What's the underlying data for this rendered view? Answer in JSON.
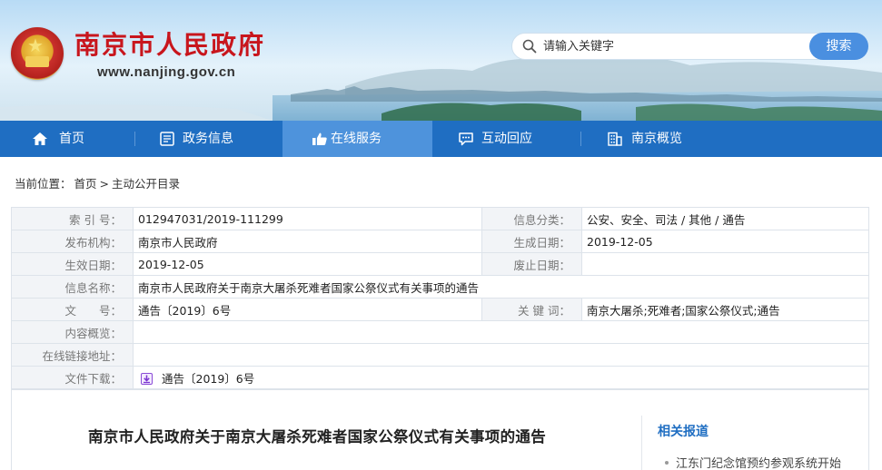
{
  "header": {
    "site_title": "南京市人民政府",
    "site_domain": "www.nanjing.gov.cn",
    "search_placeholder": "请输入关键字",
    "search_button": "搜索"
  },
  "nav": {
    "items": [
      {
        "label": "首页",
        "icon": "home-icon"
      },
      {
        "label": "政务信息",
        "icon": "document-icon"
      },
      {
        "label": "在线服务",
        "icon": "thumbs-up-icon",
        "active": true
      },
      {
        "label": "互动回应",
        "icon": "chat-icon"
      },
      {
        "label": "南京概览",
        "icon": "building-icon"
      }
    ]
  },
  "breadcrumb": {
    "prefix": "当前位置：",
    "home": "首页",
    "separator": ">",
    "current": "主动公开目录"
  },
  "info": {
    "index_label": "索 引 号：",
    "index_value": "012947031/2019-111299",
    "category_label": "信息分类：",
    "category_value": "公安、安全、司法 / 其他 / 通告",
    "publisher_label": "发布机构：",
    "publisher_value": "南京市人民政府",
    "created_label": "生成日期：",
    "created_value": "2019-12-05",
    "effective_label": "生效日期：",
    "effective_value": "2019-12-05",
    "expired_label": "废止日期：",
    "expired_value": "",
    "name_label": "信息名称：",
    "name_value": "南京市人民政府关于南京大屠杀死难者国家公祭仪式有关事项的通告",
    "docno_label": "文　　号：",
    "docno_value": "通告〔2019〕6号",
    "keywords_label": "关 键 词：",
    "keywords_value": "南京大屠杀;死难者;国家公祭仪式;通告",
    "summary_label": "内容概览：",
    "summary_value": "",
    "link_label": "在线链接地址：",
    "link_value": "",
    "download_label": "文件下载：",
    "download_value": "通告〔2019〕6号"
  },
  "article": {
    "title": "南京市人民政府关于南京大屠杀死难者国家公祭仪式有关事项的通告"
  },
  "sidebar": {
    "related_title": "相关报道",
    "items": [
      "江东门纪念馆预约参观系统开始"
    ]
  },
  "colors": {
    "brand_red": "#c8161d",
    "nav_blue": "#1f6ec2",
    "nav_active": "#4e93dc",
    "search_button": "#4a8fe0"
  }
}
